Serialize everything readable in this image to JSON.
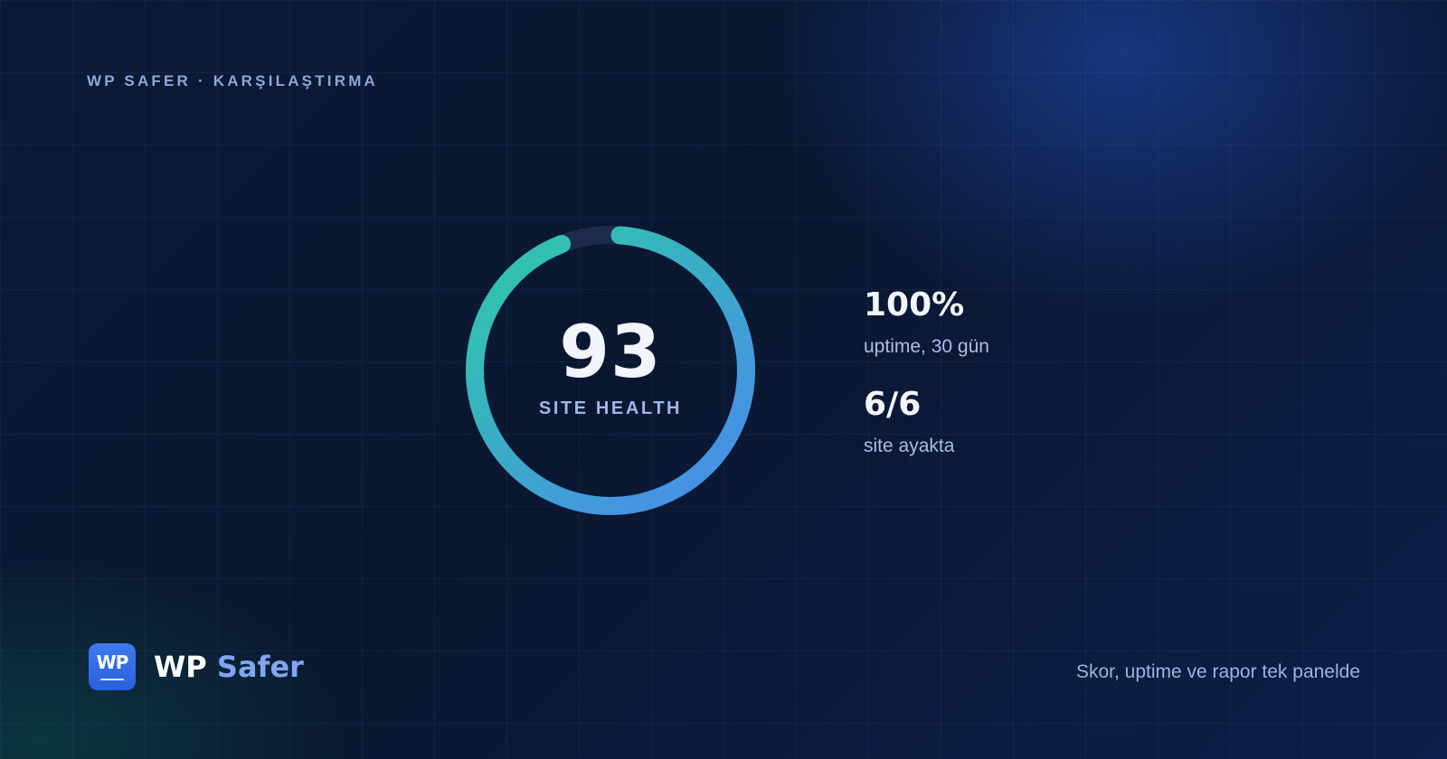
{
  "header": {
    "kicker": "WP SAFER · KARŞILAŞTIRMA"
  },
  "gauge": {
    "score": "93",
    "label": "SITE HEALTH",
    "fill_fraction": 0.93,
    "colors": {
      "start": "#2ecaa6",
      "end": "#4a88ee",
      "track": "#1c2b4b"
    }
  },
  "stats": [
    {
      "value": "100%",
      "label": "uptime, 30 gün"
    },
    {
      "value": "6/6",
      "label": "site ayakta"
    }
  ],
  "brand": {
    "logo_text": "WP",
    "name_primary": "WP",
    "name_accent": "Safer"
  },
  "footer": {
    "tagline": "Skor, uptime ve rapor tek panelde"
  },
  "colors": {
    "accent": "#7fa6f3",
    "logo": "#3a72ea",
    "background": "#0b1730"
  }
}
